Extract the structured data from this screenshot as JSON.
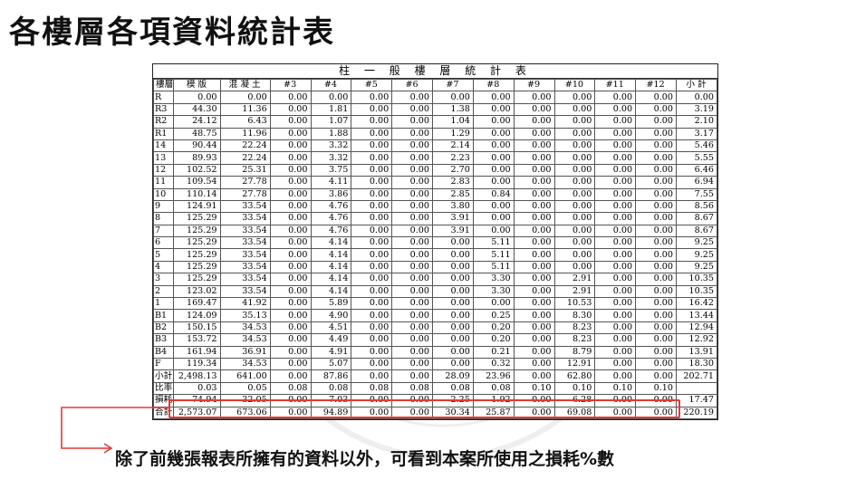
{
  "slide": {
    "title": "各樓層各項資料統計表",
    "caption": "除了前幾張報表所擁有的資料以外，可看到本案所使用之損耗%數"
  },
  "sheet": {
    "title": "柱 一 般 樓 層 統 計 表",
    "headers": [
      "樓層",
      "模 版",
      "混 凝 土",
      "#3",
      "#4",
      "#5",
      "#6",
      "#7",
      "#8",
      "#9",
      "#10",
      "#11",
      "#12",
      "小 計"
    ],
    "rows": [
      [
        "R",
        "0.00",
        "0.00",
        "0.00",
        "0.00",
        "0.00",
        "0.00",
        "0.00",
        "0.00",
        "0.00",
        "0.00",
        "0.00",
        "0.00",
        "0.00"
      ],
      [
        "R3",
        "44.30",
        "11.36",
        "0.00",
        "1.81",
        "0.00",
        "0.00",
        "1.38",
        "0.00",
        "0.00",
        "0.00",
        "0.00",
        "0.00",
        "3.19"
      ],
      [
        "R2",
        "24.12",
        "6.43",
        "0.00",
        "1.07",
        "0.00",
        "0.00",
        "1.04",
        "0.00",
        "0.00",
        "0.00",
        "0.00",
        "0.00",
        "2.10"
      ],
      [
        "R1",
        "48.75",
        "11.96",
        "0.00",
        "1.88",
        "0.00",
        "0.00",
        "1.29",
        "0.00",
        "0.00",
        "0.00",
        "0.00",
        "0.00",
        "3.17"
      ],
      [
        "14",
        "90.44",
        "22.24",
        "0.00",
        "3.32",
        "0.00",
        "0.00",
        "2.14",
        "0.00",
        "0.00",
        "0.00",
        "0.00",
        "0.00",
        "5.46"
      ],
      [
        "13",
        "89.93",
        "22.24",
        "0.00",
        "3.32",
        "0.00",
        "0.00",
        "2.23",
        "0.00",
        "0.00",
        "0.00",
        "0.00",
        "0.00",
        "5.55"
      ],
      [
        "12",
        "102.52",
        "25.31",
        "0.00",
        "3.75",
        "0.00",
        "0.00",
        "2.70",
        "0.00",
        "0.00",
        "0.00",
        "0.00",
        "0.00",
        "6.46"
      ],
      [
        "11",
        "109.54",
        "27.78",
        "0.00",
        "4.11",
        "0.00",
        "0.00",
        "2.83",
        "0.00",
        "0.00",
        "0.00",
        "0.00",
        "0.00",
        "6.94"
      ],
      [
        "10",
        "110.14",
        "27.78",
        "0.00",
        "3.86",
        "0.00",
        "0.00",
        "2.85",
        "0.84",
        "0.00",
        "0.00",
        "0.00",
        "0.00",
        "7.55"
      ],
      [
        "9",
        "124.91",
        "33.54",
        "0.00",
        "4.76",
        "0.00",
        "0.00",
        "3.80",
        "0.00",
        "0.00",
        "0.00",
        "0.00",
        "0.00",
        "8.56"
      ],
      [
        "8",
        "125.29",
        "33.54",
        "0.00",
        "4.76",
        "0.00",
        "0.00",
        "3.91",
        "0.00",
        "0.00",
        "0.00",
        "0.00",
        "0.00",
        "8.67"
      ],
      [
        "7",
        "125.29",
        "33.54",
        "0.00",
        "4.76",
        "0.00",
        "0.00",
        "3.91",
        "0.00",
        "0.00",
        "0.00",
        "0.00",
        "0.00",
        "8.67"
      ],
      [
        "6",
        "125.29",
        "33.54",
        "0.00",
        "4.14",
        "0.00",
        "0.00",
        "0.00",
        "5.11",
        "0.00",
        "0.00",
        "0.00",
        "0.00",
        "9.25"
      ],
      [
        "5",
        "125.29",
        "33.54",
        "0.00",
        "4.14",
        "0.00",
        "0.00",
        "0.00",
        "5.11",
        "0.00",
        "0.00",
        "0.00",
        "0.00",
        "9.25"
      ],
      [
        "4",
        "125.29",
        "33.54",
        "0.00",
        "4.14",
        "0.00",
        "0.00",
        "0.00",
        "5.11",
        "0.00",
        "0.00",
        "0.00",
        "0.00",
        "9.25"
      ],
      [
        "3",
        "125.29",
        "33.54",
        "0.00",
        "4.14",
        "0.00",
        "0.00",
        "0.00",
        "3.30",
        "0.00",
        "2.91",
        "0.00",
        "0.00",
        "10.35"
      ],
      [
        "2",
        "123.02",
        "33.54",
        "0.00",
        "4.14",
        "0.00",
        "0.00",
        "0.00",
        "3.30",
        "0.00",
        "2.91",
        "0.00",
        "0.00",
        "10.35"
      ],
      [
        "1",
        "169.47",
        "41.92",
        "0.00",
        "5.89",
        "0.00",
        "0.00",
        "0.00",
        "0.00",
        "0.00",
        "10.53",
        "0.00",
        "0.00",
        "16.42"
      ],
      [
        "B1",
        "124.09",
        "35.13",
        "0.00",
        "4.90",
        "0.00",
        "0.00",
        "0.00",
        "0.25",
        "0.00",
        "8.30",
        "0.00",
        "0.00",
        "13.44"
      ],
      [
        "B2",
        "150.15",
        "34.53",
        "0.00",
        "4.51",
        "0.00",
        "0.00",
        "0.00",
        "0.20",
        "0.00",
        "8.23",
        "0.00",
        "0.00",
        "12.94"
      ],
      [
        "B3",
        "153.72",
        "34.53",
        "0.00",
        "4.49",
        "0.00",
        "0.00",
        "0.00",
        "0.20",
        "0.00",
        "8.23",
        "0.00",
        "0.00",
        "12.92"
      ],
      [
        "B4",
        "161.94",
        "36.91",
        "0.00",
        "4.91",
        "0.00",
        "0.00",
        "0.00",
        "0.21",
        "0.00",
        "8.79",
        "0.00",
        "0.00",
        "13.91"
      ],
      [
        "F",
        "119.34",
        "34.53",
        "0.00",
        "5.07",
        "0.00",
        "0.00",
        "0.00",
        "0.32",
        "0.00",
        "12.91",
        "0.00",
        "0.00",
        "18.30"
      ],
      [
        "小計",
        "2,498.13",
        "641.00",
        "0.00",
        "87.86",
        "0.00",
        "0.00",
        "28.09",
        "23.96",
        "0.00",
        "62.80",
        "0.00",
        "0.00",
        "202.71"
      ],
      [
        "比率",
        "0.03",
        "0.05",
        "0.08",
        "0.08",
        "0.08",
        "0.08",
        "0.08",
        "0.08",
        "0.10",
        "0.10",
        "0.10",
        "0.10",
        ""
      ],
      [
        "損耗",
        "74.94",
        "32.05",
        "0.00",
        "7.03",
        "0.00",
        "0.00",
        "2.25",
        "1.92",
        "0.00",
        "6.28",
        "0.00",
        "0.00",
        "17.47"
      ],
      [
        "合計",
        "2,573.07",
        "673.06",
        "0.00",
        "94.89",
        "0.00",
        "0.00",
        "30.34",
        "25.87",
        "0.00",
        "69.08",
        "0.00",
        "0.00",
        "220.19"
      ]
    ]
  },
  "colors": {
    "highlight": "#e53935",
    "text": "#111111"
  }
}
